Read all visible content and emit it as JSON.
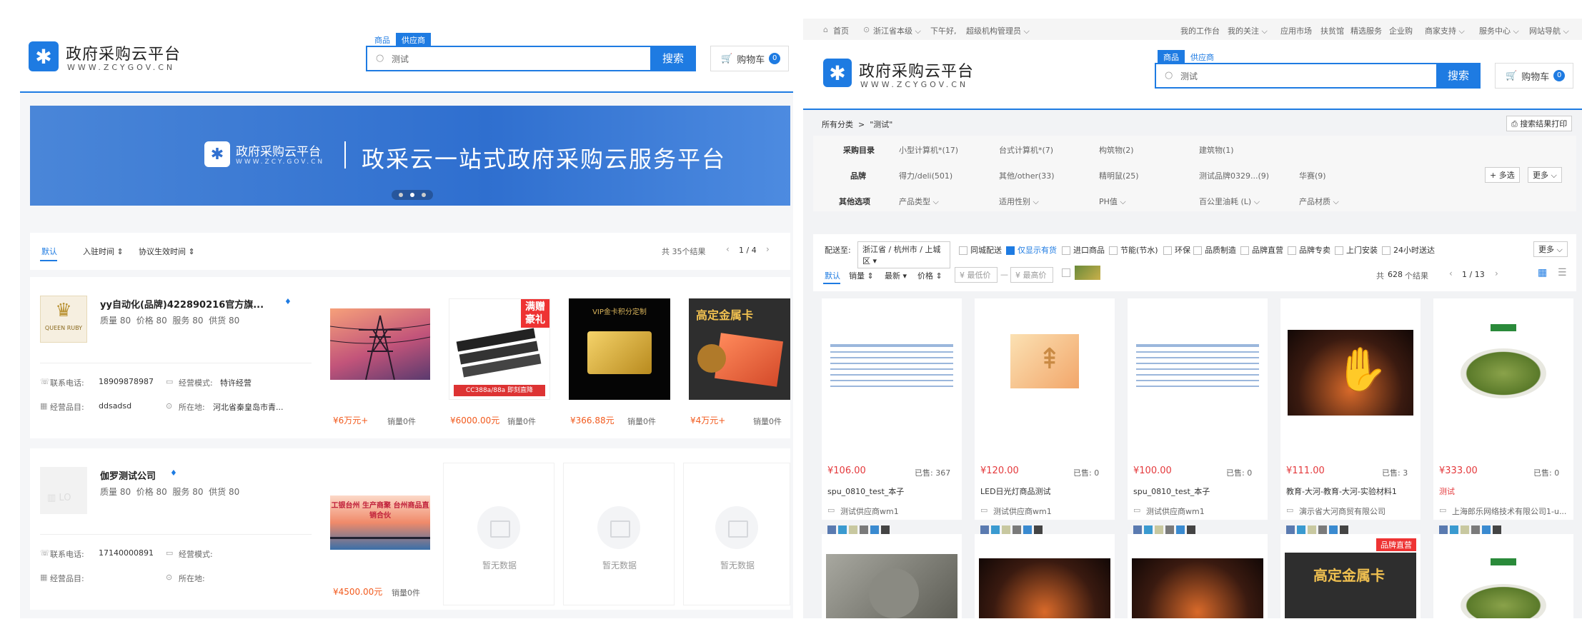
{
  "left": {
    "brand": {
      "title": "政府采购云平台",
      "sub": "WWW.ZCYGOV.CN"
    },
    "search": {
      "tabs": [
        "商品",
        "供应商"
      ],
      "query": "测试",
      "button": "搜索"
    },
    "cart": {
      "label": "购物车",
      "count": "0"
    },
    "banner": {
      "brand_title": "政府采购云平台",
      "brand_sub": "WWW.ZCY.GOV.CN",
      "slogan": "政采云一站式政府采购云服务平台"
    },
    "sort": {
      "items": [
        "默认",
        "入驻时间 ⇕",
        "协议生效时间 ⇕"
      ],
      "total": "共 35个结果",
      "page": "1 / 4"
    },
    "suppliers": [
      {
        "name": "yy自动化(品牌)422890216官方旗...",
        "ratings": "质量 80  价格 80  服务 80  供货 80",
        "phone_label": "联系电话:",
        "phone": "18909878987",
        "mode_label": "经营模式:",
        "mode": "特许经营",
        "items_label": "经营品目:",
        "items": "ddsadsd",
        "loc_label": "所在地:",
        "loc": "河北省秦皇岛市青...",
        "logo_text": "QUEEN RUBY",
        "products": [
          {
            "price": "¥6万元+",
            "sales": "销量0件"
          },
          {
            "price": "¥6000.00元",
            "sales": "销量0件",
            "promo": "满赠豪礼",
            "model": "CC388a/88a 即刻直降"
          },
          {
            "price": "¥366.88元",
            "sales": "销量0件",
            "label": "VIP金卡积分定制"
          },
          {
            "price": "¥4万元+",
            "sales": "销量0件",
            "label": "高定金属卡"
          }
        ]
      },
      {
        "name": "伽罗测试公司",
        "ratings": "质量 80  价格 80  服务 80  供货 80",
        "phone_label": "联系电话:",
        "phone": "17140000891",
        "mode_label": "经营模式:",
        "mode": "",
        "items_label": "经营品目:",
        "items": "",
        "loc_label": "所在地:",
        "loc": "",
        "products": [
          {
            "price": "¥4500.00元",
            "sales": "销量0件",
            "banner": "工银台州 生产商聚 台州商品直销合伙"
          }
        ],
        "empty": [
          "暂无数据",
          "暂无数据",
          "暂无数据"
        ]
      }
    ]
  },
  "right": {
    "topnav": {
      "left": [
        "首页",
        "浙江省本级 ⌵",
        "下午好,",
        "超级机构管理员 ⌵"
      ],
      "right": [
        "我的工作台",
        "我的关注 ⌵",
        "应用市场",
        "扶贫馆",
        "精选服务",
        "企业购",
        "商家支持 ⌵",
        "服务中心 ⌵",
        "网站导航 ⌵"
      ]
    },
    "brand": {
      "title": "政府采购云平台",
      "sub": "WWW.ZCYGOV.CN"
    },
    "search": {
      "tabs": [
        "商品",
        "供应商"
      ],
      "query": "测试",
      "button": "搜索"
    },
    "cart": {
      "label": "购物车",
      "count": "0"
    },
    "crumb": {
      "text": "所有分类  >  \"测试\"",
      "print": "搜索结果打印"
    },
    "filters": [
      {
        "label": "采购目录",
        "values": [
          "小型计算机*(17)",
          "台式计算机*(7)",
          "构筑物(2)",
          "建筑物(1)"
        ]
      },
      {
        "label": "品牌",
        "values": [
          "得力/deli(501)",
          "其他/other(33)",
          "精明鼠(25)",
          "测试品牌0329...(9)",
          "华赛(9)"
        ],
        "more": "+ 多选",
        "more2": "更多 ⌵"
      },
      {
        "label": "其他选项",
        "values": [
          "产品类型 ⌵",
          "适用性别 ⌵",
          "PH值 ⌵",
          "百公里油耗 (L) ⌵",
          "产品材质 ⌵"
        ]
      }
    ],
    "delivery": {
      "label": "配送至:",
      "region": "浙江省 / 杭州市 / 上城区",
      "options": [
        "同城配送",
        "仅显示有货",
        "进口商品",
        "节能(节水)",
        "环保",
        "品质制造",
        "品牌直营",
        "品牌专卖",
        "上门安装",
        "24小时送达"
      ],
      "more": "更多 ⌵"
    },
    "sortbar": {
      "items": [
        "默认",
        "销量 ⇕",
        "最新 ▾",
        "价格 ⇕"
      ],
      "min": "¥ 最低价",
      "max": "¥ 最高价",
      "total_pre": "共",
      "total": "628",
      "total_suf": "个结果",
      "page": "1 / 13"
    },
    "products": [
      {
        "price": "¥106.00",
        "sold": "已售: 367",
        "title": "spu_0810_test_本子",
        "shop": "测试供应商wm1"
      },
      {
        "price": "¥120.00",
        "sold": "已售: 0",
        "title": "LED日光灯商品测试",
        "shop": "测试供应商wm1"
      },
      {
        "price": "¥100.00",
        "sold": "已售: 0",
        "title": "spu_0810_test_本子",
        "shop": "测试供应商wm1"
      },
      {
        "price": "¥111.00",
        "sold": "已售: 3",
        "title": "教育-大河-教育-大河-实验材料1",
        "shop": "演示省大河商贸有限公司"
      },
      {
        "price": "¥333.00",
        "sold": "已售: 0",
        "title": "测试",
        "shop": "上海郎乐网络技术有限公司1-u..."
      }
    ],
    "row2_badge": "品牌直营",
    "row2_card4": "高定金属卡"
  },
  "colors": {
    "accent": "#1e7be2",
    "price": "#e4393c",
    "orange": "#f25a1d"
  }
}
